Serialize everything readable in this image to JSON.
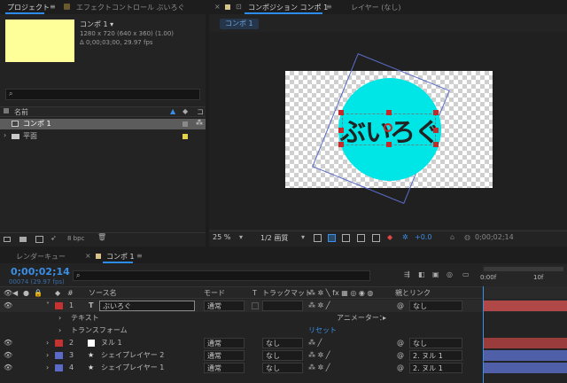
{
  "project_panel": {
    "tab_project": "プロジェクト",
    "tab_effects": "エフェクトコントロール ぶいろぐ",
    "comp_name": "コンポ 1 ▾",
    "comp_size": "1280 x 720  (640 x 360) (1.00)",
    "comp_duration": "Δ 0;00;03;00, 29.97 fps",
    "search_placeholder": "",
    "col_name": "名前",
    "items": [
      {
        "name": "コンポ 1",
        "type": "comp"
      },
      {
        "name": "平面",
        "type": "folder"
      }
    ],
    "bpc": "8 bpc",
    "thumb_color": "#ffff99"
  },
  "comp_panel": {
    "tab_comp": "コンポジション コンポ 1",
    "tab_layer": "レイヤー (なし)",
    "breadcrumb": "コンポ 1",
    "logo_text": "ぶいろぐ",
    "circle_color": "#00e5e5",
    "zoom": "25 %",
    "quality": "1/2 画質",
    "exposure": "+0.0",
    "timecode": "0;00;02;14"
  },
  "timeline": {
    "tab_render": "レンダーキュー",
    "tab_comp": "コンポ 1",
    "timecode": "0;00;02;14",
    "frames": "00074 (29.97 fps)",
    "ruler_labels": [
      "0:00f",
      "10f"
    ],
    "headers": {
      "source": "ソース名",
      "mode": "モード",
      "t": "T",
      "track": "トラックマット",
      "parent": "親とリンク"
    },
    "layers": [
      {
        "num": "1",
        "name": "ぶいろぐ",
        "type_glyph": "T",
        "label_color": "#c43232",
        "mode": "通常",
        "track": "",
        "parent": "なし",
        "bar_color": "#b04848"
      },
      {
        "num": "2",
        "name": "ヌル 1",
        "type_glyph": "□",
        "label_color": "#c43232",
        "mode": "通常",
        "track": "なし",
        "parent": "なし",
        "bar_color": "#9a3c3c"
      },
      {
        "num": "3",
        "name": "シェイプレイヤー 2",
        "type_glyph": "★",
        "label_color": "#5a6bc8",
        "mode": "通常",
        "track": "なし",
        "parent": "2. ヌル 1",
        "bar_color": "#5060a8"
      },
      {
        "num": "4",
        "name": "シェイプレイヤー 1",
        "type_glyph": "★",
        "label_color": "#5a6bc8",
        "mode": "通常",
        "track": "なし",
        "parent": "2. ヌル 1",
        "bar_color": "#5060a8"
      }
    ],
    "sub_text": "テキスト",
    "sub_transform": "トランスフォーム",
    "animator": "アニメーター：",
    "reset": "リセット"
  }
}
